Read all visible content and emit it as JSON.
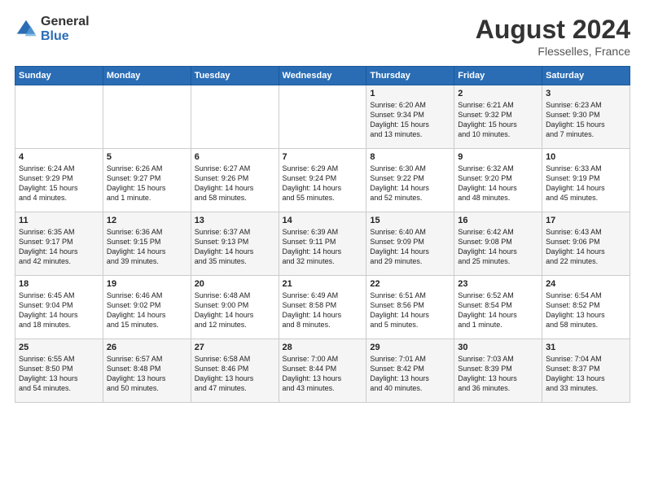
{
  "header": {
    "logo_general": "General",
    "logo_blue": "Blue",
    "month_year": "August 2024",
    "location": "Flesselles, France"
  },
  "days_of_week": [
    "Sunday",
    "Monday",
    "Tuesday",
    "Wednesday",
    "Thursday",
    "Friday",
    "Saturday"
  ],
  "weeks": [
    [
      {
        "day": "",
        "content": ""
      },
      {
        "day": "",
        "content": ""
      },
      {
        "day": "",
        "content": ""
      },
      {
        "day": "",
        "content": ""
      },
      {
        "day": "1",
        "content": "Sunrise: 6:20 AM\nSunset: 9:34 PM\nDaylight: 15 hours\nand 13 minutes."
      },
      {
        "day": "2",
        "content": "Sunrise: 6:21 AM\nSunset: 9:32 PM\nDaylight: 15 hours\nand 10 minutes."
      },
      {
        "day": "3",
        "content": "Sunrise: 6:23 AM\nSunset: 9:30 PM\nDaylight: 15 hours\nand 7 minutes."
      }
    ],
    [
      {
        "day": "4",
        "content": "Sunrise: 6:24 AM\nSunset: 9:29 PM\nDaylight: 15 hours\nand 4 minutes."
      },
      {
        "day": "5",
        "content": "Sunrise: 6:26 AM\nSunset: 9:27 PM\nDaylight: 15 hours\nand 1 minute."
      },
      {
        "day": "6",
        "content": "Sunrise: 6:27 AM\nSunset: 9:26 PM\nDaylight: 14 hours\nand 58 minutes."
      },
      {
        "day": "7",
        "content": "Sunrise: 6:29 AM\nSunset: 9:24 PM\nDaylight: 14 hours\nand 55 minutes."
      },
      {
        "day": "8",
        "content": "Sunrise: 6:30 AM\nSunset: 9:22 PM\nDaylight: 14 hours\nand 52 minutes."
      },
      {
        "day": "9",
        "content": "Sunrise: 6:32 AM\nSunset: 9:20 PM\nDaylight: 14 hours\nand 48 minutes."
      },
      {
        "day": "10",
        "content": "Sunrise: 6:33 AM\nSunset: 9:19 PM\nDaylight: 14 hours\nand 45 minutes."
      }
    ],
    [
      {
        "day": "11",
        "content": "Sunrise: 6:35 AM\nSunset: 9:17 PM\nDaylight: 14 hours\nand 42 minutes."
      },
      {
        "day": "12",
        "content": "Sunrise: 6:36 AM\nSunset: 9:15 PM\nDaylight: 14 hours\nand 39 minutes."
      },
      {
        "day": "13",
        "content": "Sunrise: 6:37 AM\nSunset: 9:13 PM\nDaylight: 14 hours\nand 35 minutes."
      },
      {
        "day": "14",
        "content": "Sunrise: 6:39 AM\nSunset: 9:11 PM\nDaylight: 14 hours\nand 32 minutes."
      },
      {
        "day": "15",
        "content": "Sunrise: 6:40 AM\nSunset: 9:09 PM\nDaylight: 14 hours\nand 29 minutes."
      },
      {
        "day": "16",
        "content": "Sunrise: 6:42 AM\nSunset: 9:08 PM\nDaylight: 14 hours\nand 25 minutes."
      },
      {
        "day": "17",
        "content": "Sunrise: 6:43 AM\nSunset: 9:06 PM\nDaylight: 14 hours\nand 22 minutes."
      }
    ],
    [
      {
        "day": "18",
        "content": "Sunrise: 6:45 AM\nSunset: 9:04 PM\nDaylight: 14 hours\nand 18 minutes."
      },
      {
        "day": "19",
        "content": "Sunrise: 6:46 AM\nSunset: 9:02 PM\nDaylight: 14 hours\nand 15 minutes."
      },
      {
        "day": "20",
        "content": "Sunrise: 6:48 AM\nSunset: 9:00 PM\nDaylight: 14 hours\nand 12 minutes."
      },
      {
        "day": "21",
        "content": "Sunrise: 6:49 AM\nSunset: 8:58 PM\nDaylight: 14 hours\nand 8 minutes."
      },
      {
        "day": "22",
        "content": "Sunrise: 6:51 AM\nSunset: 8:56 PM\nDaylight: 14 hours\nand 5 minutes."
      },
      {
        "day": "23",
        "content": "Sunrise: 6:52 AM\nSunset: 8:54 PM\nDaylight: 14 hours\nand 1 minute."
      },
      {
        "day": "24",
        "content": "Sunrise: 6:54 AM\nSunset: 8:52 PM\nDaylight: 13 hours\nand 58 minutes."
      }
    ],
    [
      {
        "day": "25",
        "content": "Sunrise: 6:55 AM\nSunset: 8:50 PM\nDaylight: 13 hours\nand 54 minutes."
      },
      {
        "day": "26",
        "content": "Sunrise: 6:57 AM\nSunset: 8:48 PM\nDaylight: 13 hours\nand 50 minutes."
      },
      {
        "day": "27",
        "content": "Sunrise: 6:58 AM\nSunset: 8:46 PM\nDaylight: 13 hours\nand 47 minutes."
      },
      {
        "day": "28",
        "content": "Sunrise: 7:00 AM\nSunset: 8:44 PM\nDaylight: 13 hours\nand 43 minutes."
      },
      {
        "day": "29",
        "content": "Sunrise: 7:01 AM\nSunset: 8:42 PM\nDaylight: 13 hours\nand 40 minutes."
      },
      {
        "day": "30",
        "content": "Sunrise: 7:03 AM\nSunset: 8:39 PM\nDaylight: 13 hours\nand 36 minutes."
      },
      {
        "day": "31",
        "content": "Sunrise: 7:04 AM\nSunset: 8:37 PM\nDaylight: 13 hours\nand 33 minutes."
      }
    ]
  ]
}
